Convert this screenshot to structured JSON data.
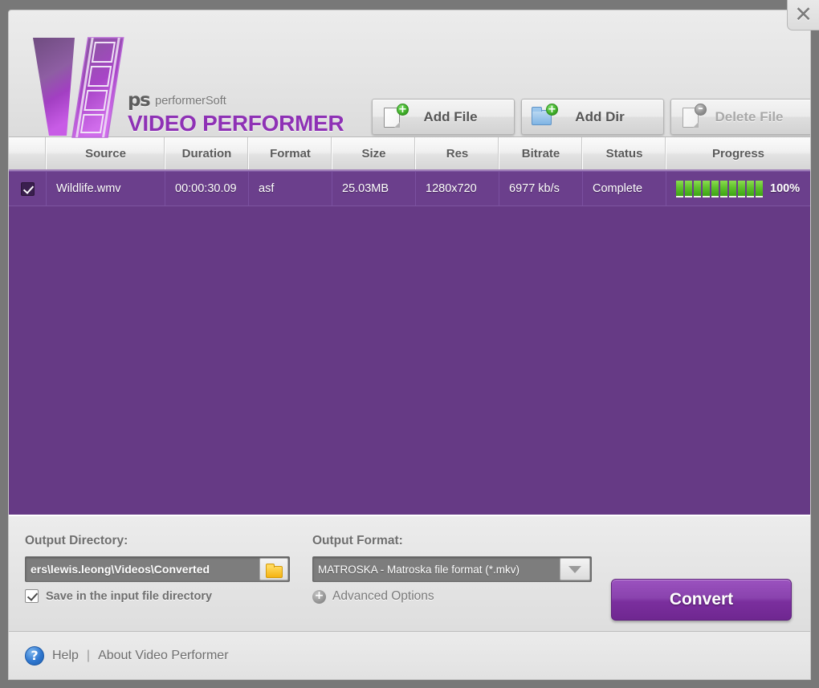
{
  "window": {
    "close_label": "✕",
    "accent_purple": "#663a85",
    "brand_purple": "#8e31b5"
  },
  "brand": {
    "ps_mark": "ps",
    "company": "performerSoft",
    "product": "VIDEO PERFORMER"
  },
  "toolbar": {
    "buttons": [
      {
        "label": "Add File",
        "icon": "document-plus-icon",
        "disabled": false
      },
      {
        "label": "Add Dir",
        "icon": "folder-plus-icon",
        "disabled": false
      },
      {
        "label": "Delete File",
        "icon": "document-minus-icon",
        "disabled": true
      }
    ],
    "plus_glyph": "+",
    "minus_glyph": "–"
  },
  "table": {
    "columns": [
      "",
      "Source",
      "Duration",
      "Format",
      "Size",
      "Res",
      "Bitrate",
      "Status",
      "Progress"
    ],
    "rows": [
      {
        "checked": true,
        "source": "Wildlife.wmv",
        "duration": "00:00:30.09",
        "format": "asf",
        "size": "25.03MB",
        "res": "1280x720",
        "bitrate": "6977 kb/s",
        "status": "Complete",
        "progress_percent": 100,
        "progress_label": "100%",
        "progress_segments": 10
      }
    ]
  },
  "options": {
    "output_directory_label": "Output Directory:",
    "output_directory_value": "ers\\lewis.leong\\Videos\\Converted",
    "browse_icon": "folder-icon",
    "save_in_input_dir_label": "Save in the input file directory",
    "save_in_input_dir_checked": true,
    "output_format_label": "Output Format:",
    "output_format_value": "MATROSKA - Matroska file format (*.mkv)",
    "output_format_options": [
      "MATROSKA - Matroska file format (*.mkv)"
    ],
    "advanced_options_label": "Advanced Options",
    "advanced_plus_glyph": "+",
    "convert_label": "Convert"
  },
  "footer": {
    "help_glyph": "?",
    "help_label": "Help",
    "separator": "|",
    "about_label": "About Video Performer"
  }
}
